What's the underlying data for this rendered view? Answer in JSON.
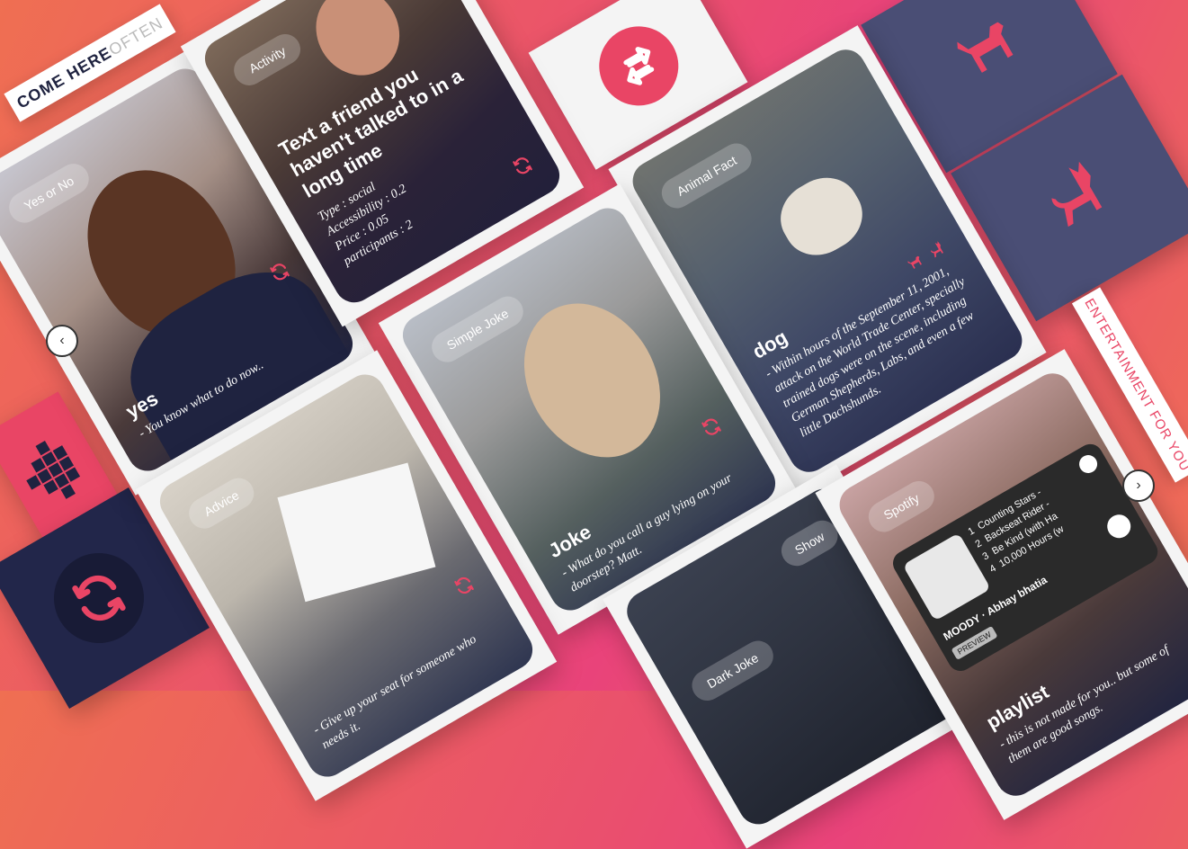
{
  "banners": {
    "come_here_strong": "COME HERE ",
    "come_here_light": "OFTEN",
    "entertainment": "ENTERTAINMENT FOR YOU"
  },
  "cards": {
    "yes_or_no": {
      "tag": "Yes or No",
      "title": "yes",
      "body": "- You know what to do now.."
    },
    "activity": {
      "tag": "Activity",
      "title": "Text a friend you haven't talked to in a long time",
      "type": "Type : social",
      "accessibility": "Accessibility : 0.2",
      "price": "Price : 0.05",
      "participants": "participants : 2"
    },
    "animal_fact": {
      "tag": "Animal Fact",
      "title": "dog",
      "body": "- Within hours of the September 11, 2001, attack on the World Trade Center, specially trained dogs were on the scene, including German Shepherds, Labs, and even a few little Dachshunds."
    },
    "simple_joke": {
      "tag": "Simple Joke",
      "title": "Joke",
      "body": "- What do you call a guy lying on your doorstep? Matt."
    },
    "advice": {
      "tag": "Advice",
      "body": "- Give up your seat for someone who needs it."
    },
    "dark_joke": {
      "tag": "Dark Joke",
      "show_label": "Show"
    },
    "spotify": {
      "tag": "Spotify",
      "title": "playlist",
      "body": "- this is not made for you.. but some of them are good songs.",
      "widget": {
        "tracks": [
          {
            "num": "1",
            "name": "Counting Stars -"
          },
          {
            "num": "2",
            "name": "Backseat Rider -"
          },
          {
            "num": "3",
            "name": "Be Kind (with Ha"
          },
          {
            "num": "4",
            "name": "10,000 Hours (w"
          }
        ],
        "album": "MOODY · Abhay bhatia",
        "badge": "PREVIEW"
      }
    }
  },
  "icons": {
    "refresh": "refresh-icon",
    "dog": "dog-icon",
    "cat": "cat-icon"
  },
  "colors": {
    "accent": "#e94565",
    "navy": "#1f2340",
    "slate": "#4a4e75"
  }
}
